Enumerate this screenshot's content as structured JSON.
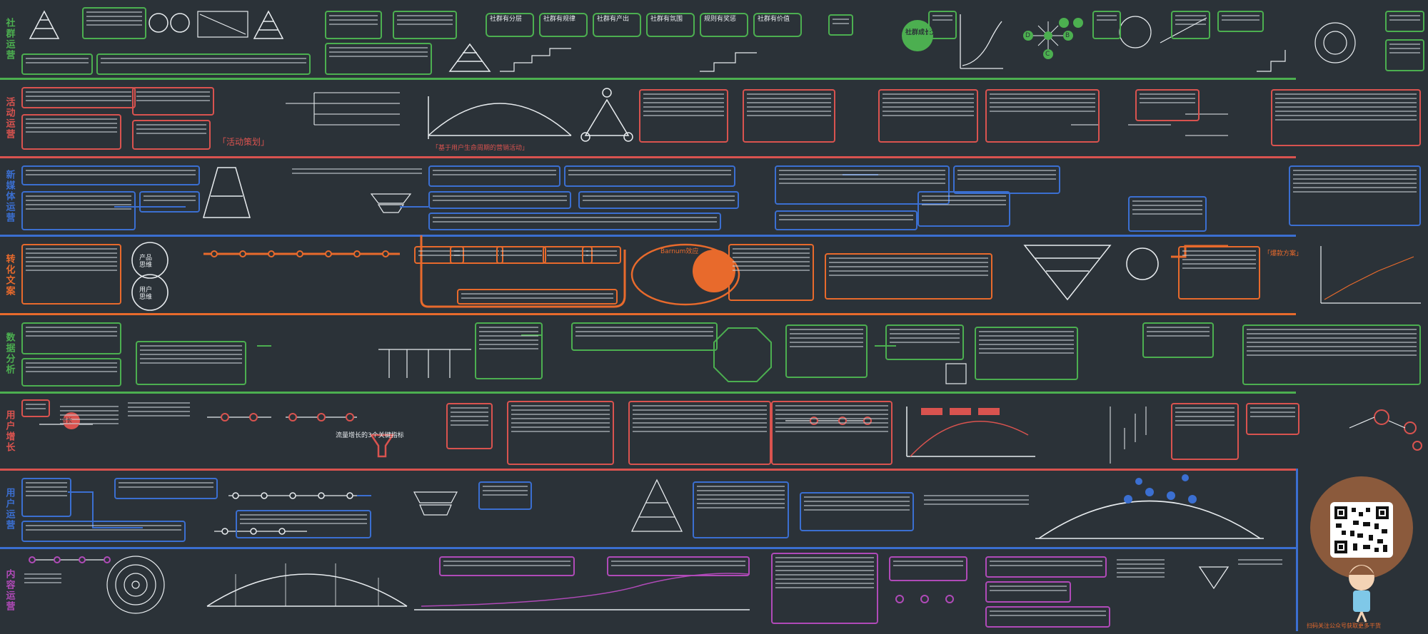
{
  "colors": {
    "background": "#2b3238",
    "community": "#4caf50",
    "activity": "#d9534f",
    "newmedia": "#3b6fd1",
    "conversion": "#e86a2c",
    "data": "#4caf50",
    "growth": "#d9534f",
    "userops": "#3b6fd1",
    "content": "#b04ab8",
    "qr_frame": "#8b5a3c"
  },
  "sections": [
    {
      "id": "community",
      "label": "社群运营"
    },
    {
      "id": "activity",
      "label": "活动运营"
    },
    {
      "id": "newmedia",
      "label": "新媒体运营"
    },
    {
      "id": "conversion",
      "label": "转化文案"
    },
    {
      "id": "data",
      "label": "数据分析"
    },
    {
      "id": "growth",
      "label": "用户增长"
    },
    {
      "id": "userops",
      "label": "用户运营"
    },
    {
      "id": "content",
      "label": "内容运营"
    }
  ],
  "community": {
    "boxes": [
      "社群有分层",
      "社群有规律",
      "社群有产出",
      "社群有氛围",
      "规则有奖惩",
      "社群有价值"
    ],
    "growth_node": "社群成长力",
    "abcdef": [
      "A",
      "B",
      "C",
      "D",
      "E",
      "F"
    ]
  },
  "activity": {
    "title": "「活动策划」",
    "arc_caption": "「基于用户生命周期的营销活动」"
  },
  "conversion": {
    "product": "产品\n思维",
    "user": "用户\n思维",
    "barnum": "Barnum效应",
    "case": "「爆款方案」"
  },
  "growth": {
    "circle_label": "增长",
    "funnel_caption": "流量增长的3个关键指标"
  },
  "qr": {
    "caption": "扫码关注公众号获取更多干货"
  }
}
